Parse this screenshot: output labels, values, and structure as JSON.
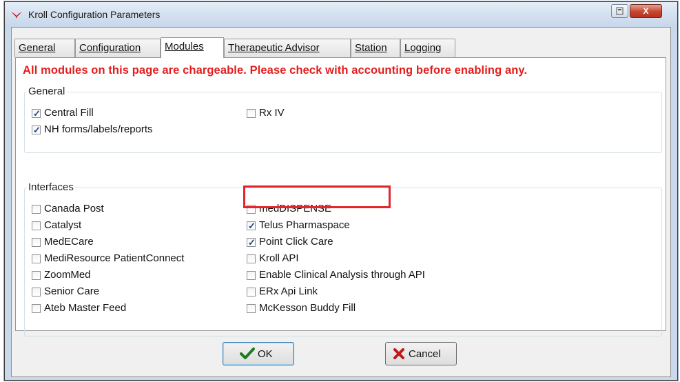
{
  "window": {
    "title": "Kroll Configuration Parameters",
    "close_glyph": "X"
  },
  "tabs": [
    {
      "label": "General",
      "active": false
    },
    {
      "label": "Configuration",
      "active": false
    },
    {
      "label": "Modules",
      "active": true
    },
    {
      "label": "Therapeutic Advisor",
      "active": false
    },
    {
      "label": "Station",
      "active": false
    },
    {
      "label": "Logging",
      "active": false
    }
  ],
  "warning": "All modules on this page are chargeable.  Please check with accounting before enabling any.",
  "general_group": {
    "label": "General",
    "items": [
      {
        "label": "Central Fill",
        "checked": true
      },
      {
        "label": "NH forms/labels/reports",
        "checked": true
      },
      {
        "label": "Rx IV",
        "checked": false
      }
    ]
  },
  "interfaces_group": {
    "label": "Interfaces",
    "left": [
      {
        "label": "Canada Post",
        "checked": false
      },
      {
        "label": "Catalyst",
        "checked": false
      },
      {
        "label": "MedECare",
        "checked": false
      },
      {
        "label": "MediResource PatientConnect",
        "checked": false
      },
      {
        "label": "ZoomMed",
        "checked": false
      },
      {
        "label": "Senior Care",
        "checked": false
      },
      {
        "label": "Ateb Master Feed",
        "checked": false
      }
    ],
    "right": [
      {
        "label": "medDISPENSE",
        "checked": false
      },
      {
        "label": "Telus Pharmaspace",
        "checked": true
      },
      {
        "label": "Point Click Care",
        "checked": true
      },
      {
        "label": "Kroll API",
        "checked": false
      },
      {
        "label": "Enable Clinical Analysis through API",
        "checked": false
      },
      {
        "label": "ERx Api Link",
        "checked": false
      },
      {
        "label": "McKesson Buddy Fill",
        "checked": false
      }
    ]
  },
  "buttons": {
    "ok": "OK",
    "cancel": "Cancel"
  },
  "colors": {
    "warning": "#e51c1c",
    "highlight": "#e3242b",
    "check": "#23418f"
  }
}
